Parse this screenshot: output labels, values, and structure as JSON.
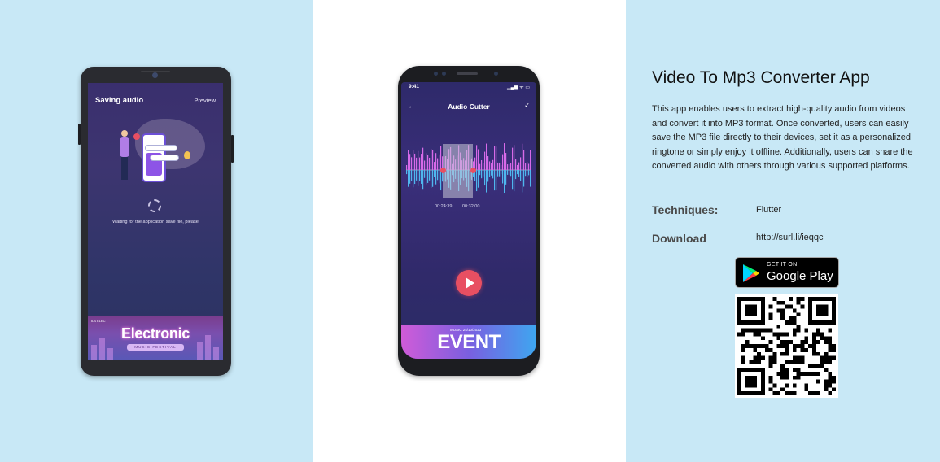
{
  "screen1": {
    "title": "Saving audio",
    "preview_label": "Preview",
    "waiting_text": "Waiting for the application save file, please",
    "banner_small": "ILS ELEC",
    "banner_title": "Electronic",
    "banner_subtitle": "MUSIC FESTIVAL"
  },
  "screen2": {
    "time": "9:41",
    "status_icons": "▂▄▆ ᯤ ▭",
    "back_icon": "←",
    "title": "Audio Cutter",
    "check_icon": "✓",
    "start_time": "00:24:39",
    "end_time": "00:32:00",
    "banner_small": "MUSIC  24/10/2023",
    "banner_title": "EVENT"
  },
  "app": {
    "title": "Video To Mp3 Converter App",
    "description": "This app enables users to extract high-quality audio from videos and convert it into MP3 format. Once converted, users can easily save the MP3 file directly to their devices, set it as a personalized ringtone or simply enjoy it offline. Additionally, users can share the converted audio with others through various supported platforms.",
    "techniques_label": "Techniques:",
    "techniques_value": "Flutter",
    "download_label": "Download",
    "download_value": "http://surl.li/ieqqc",
    "store_badge_small": "GET IT ON",
    "store_badge_big": "Google Play"
  },
  "colors": {
    "panel_bg": "#c8e8f6",
    "accent_red": "#e84f62",
    "screen_purple": "#3a2e7a"
  }
}
